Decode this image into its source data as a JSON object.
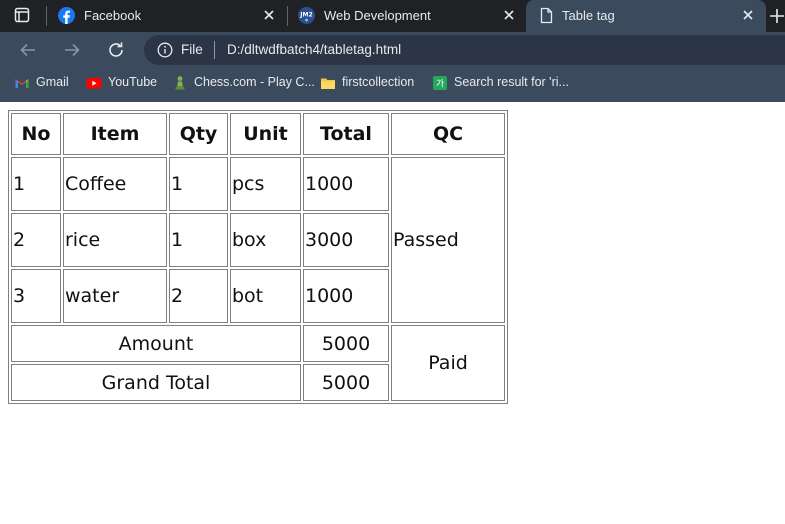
{
  "browser": {
    "tabs": [
      {
        "label": "Facebook",
        "icon": "facebook-icon"
      },
      {
        "label": "Web Development",
        "icon": "jm2-icon"
      },
      {
        "label": "Table tag",
        "icon": "document-icon",
        "active": true
      }
    ],
    "address": {
      "info_label": "File",
      "url": "D:/dltwdfbatch4/tabletag.html"
    },
    "bookmarks": [
      {
        "label": "Gmail",
        "icon": "gmail-icon"
      },
      {
        "label": "YouTube",
        "icon": "youtube-icon"
      },
      {
        "label": "Chess.com - Play C...",
        "icon": "chess-icon"
      },
      {
        "label": "firstcollection",
        "icon": "folder-icon"
      },
      {
        "label": "Search result for 'ri...",
        "icon": "translate-icon"
      }
    ]
  },
  "table": {
    "headers": [
      "No",
      "Item",
      "Qty",
      "Unit",
      "Total",
      "QC"
    ],
    "rows": [
      [
        "1",
        "Coffee",
        "1",
        "pcs",
        "1000"
      ],
      [
        "2",
        "rice",
        "1",
        "box",
        "3000"
      ],
      [
        "3",
        "water",
        "2",
        "bot",
        "1000"
      ]
    ],
    "qc_status": "Passed",
    "amount_label": "Amount",
    "amount_value": "5000",
    "grand_total_label": "Grand Total",
    "grand_total_value": "5000",
    "payment_status": "Paid"
  }
}
